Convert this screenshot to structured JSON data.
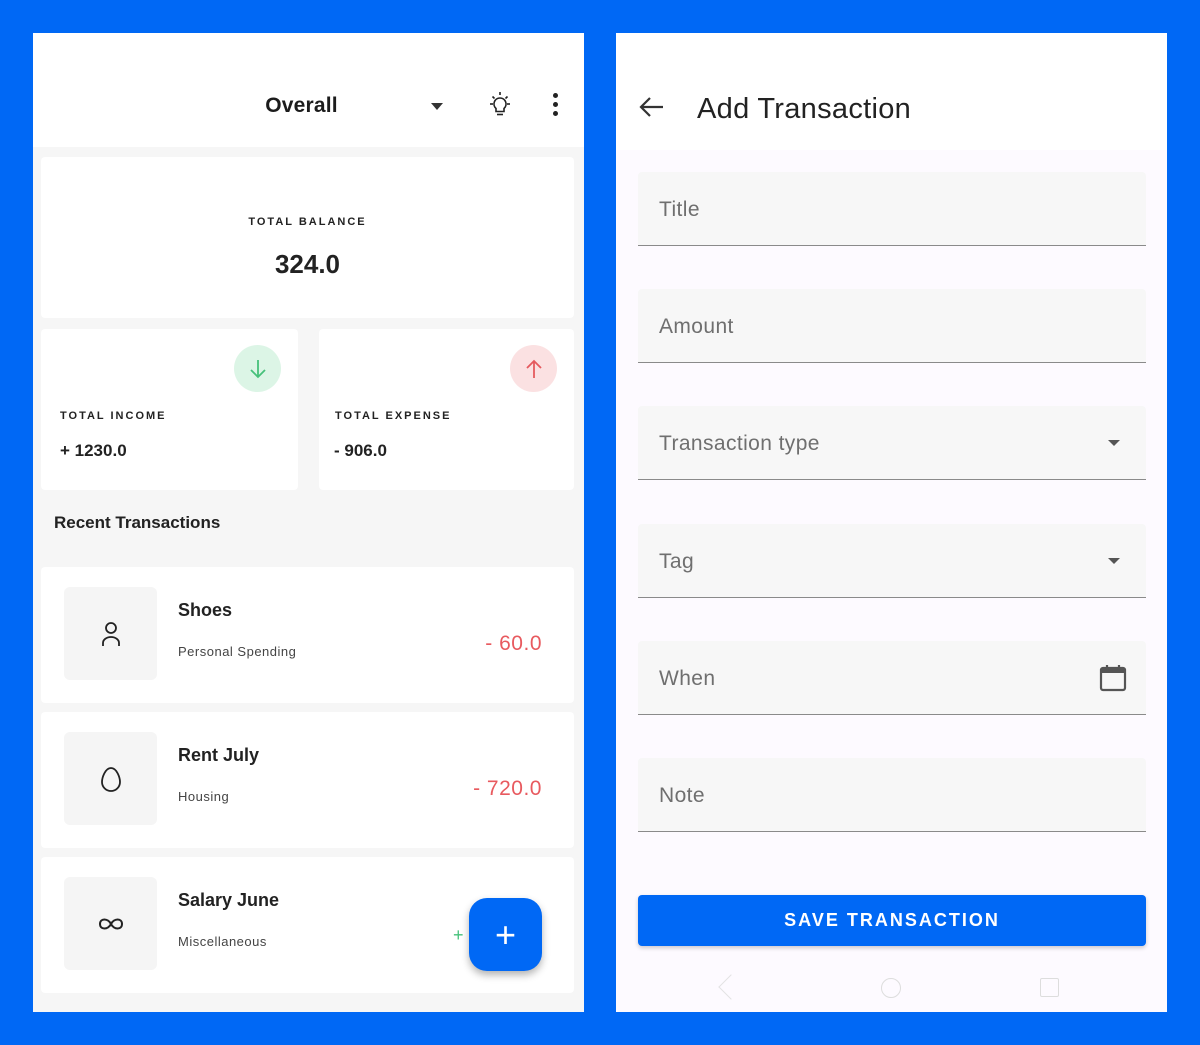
{
  "left": {
    "header": {
      "title": "Overall"
    },
    "balance": {
      "label": "TOTAL BALANCE",
      "value": "324.0"
    },
    "income": {
      "label": "TOTAL INCOME",
      "value": "+ 1230.0",
      "icon": "arrow-down-icon",
      "color": "#46c17a"
    },
    "expense": {
      "label": "TOTAL EXPENSE",
      "value": "- 906.0",
      "icon": "arrow-up-icon",
      "color": "#e85a5f"
    },
    "recent_title": "Recent Transactions",
    "transactions": [
      {
        "title": "Shoes",
        "tag": "Personal Spending",
        "amount": "- 60.0",
        "icon": "person-icon"
      },
      {
        "title": "Rent July",
        "tag": "Housing",
        "amount": "- 720.0",
        "icon": "egg-icon"
      },
      {
        "title": "Salary June",
        "tag": "Miscellaneous",
        "amount": "+",
        "icon": "infinity-icon"
      }
    ],
    "fab_label": "+"
  },
  "right": {
    "header": {
      "title": "Add Transaction"
    },
    "fields": {
      "title": "Title",
      "amount": "Amount",
      "type": "Transaction type",
      "tag": "Tag",
      "when": "When",
      "note": "Note"
    },
    "save_label": "SAVE TRANSACTION"
  },
  "colors": {
    "brand": "#0068F5",
    "expense": "#e85a5f",
    "income": "#46c17a"
  }
}
